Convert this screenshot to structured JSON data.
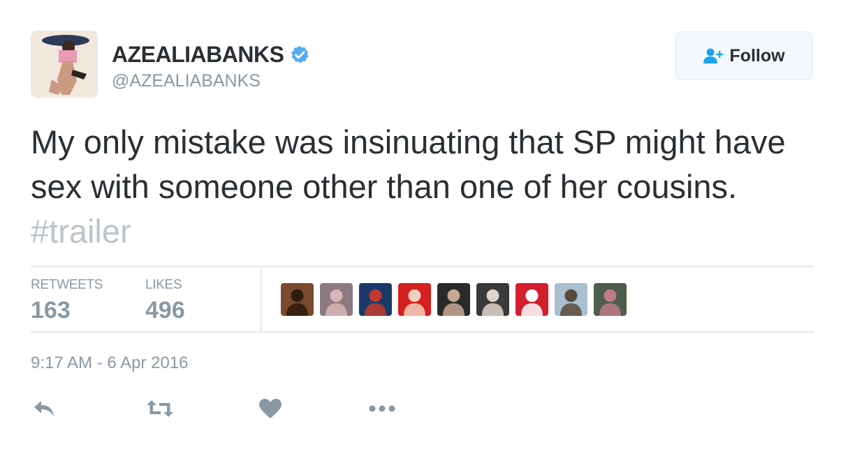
{
  "user": {
    "display_name": "AZEALIABANKS",
    "handle": "@AZEALIABANKS",
    "verified": true
  },
  "follow_button": {
    "label": "Follow",
    "icon": "add-user-icon"
  },
  "tweet": {
    "text": "My only mistake was insinuating that SP might have sex with someone other than one of her cousins.",
    "hashtag": "#trailer"
  },
  "stats": {
    "retweets_label": "RETWEETS",
    "retweets_count": "163",
    "likes_label": "LIKES",
    "likes_count": "496"
  },
  "liked_by_avatars": [
    {
      "bg": "#7a4a2c",
      "fg": "#2d1a10"
    },
    {
      "bg": "#8c7a80",
      "fg": "#d9b5b8"
    },
    {
      "bg": "#1b3a6b",
      "fg": "#c23b2c"
    },
    {
      "bg": "#d61f1f",
      "fg": "#f3d0c0"
    },
    {
      "bg": "#2a2a2a",
      "fg": "#c9a893"
    },
    {
      "bg": "#3a3a3a",
      "fg": "#e0d5cc"
    },
    {
      "bg": "#d21e2e",
      "fg": "#ffffff"
    },
    {
      "bg": "#a8c0d0",
      "fg": "#5a4a3a"
    },
    {
      "bg": "#4d5e4a",
      "fg": "#c07a8a"
    }
  ],
  "timestamp": "9:17 AM - 6 Apr 2016",
  "actions": [
    "reply-icon",
    "retweet-icon",
    "like-icon",
    "more-icon"
  ],
  "colors": {
    "text": "#292f33",
    "muted": "#8899a6",
    "hashtag": "#bcc4cb",
    "verified": "#55acee",
    "follow_icon": "#1da1f2",
    "divider": "#e1e8ed"
  }
}
